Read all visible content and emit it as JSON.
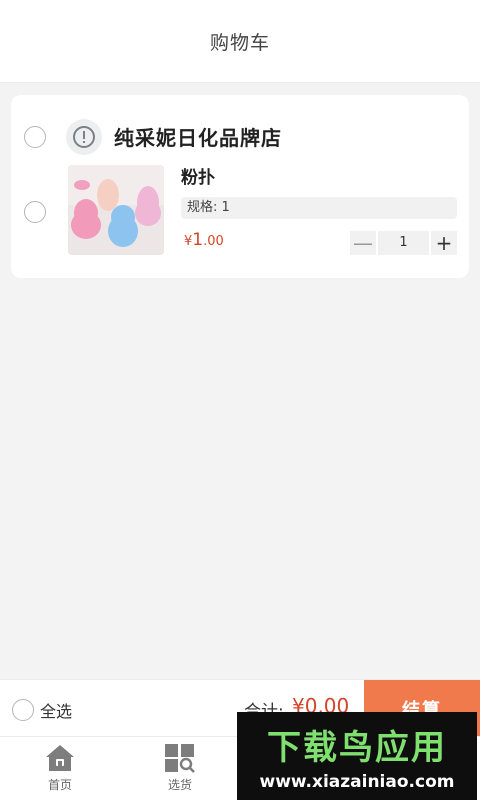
{
  "header": {
    "title": "购物车"
  },
  "shop": {
    "name": "纯采妮日化品牌店",
    "item": {
      "title": "粉扑",
      "spec": "规格: 1",
      "price_currency": "¥",
      "price_int": "1",
      "price_dec": ".00",
      "quantity": "1",
      "minus_label": "—",
      "plus_label": "+"
    }
  },
  "summary": {
    "select_all_label": "全选",
    "total_label": "合计:",
    "total_value": "¥0.00",
    "checkout_label": "结算"
  },
  "tabbar": {
    "items": [
      {
        "label": "首页",
        "icon": "home-icon"
      },
      {
        "label": "选货",
        "icon": "grid-search-icon"
      }
    ]
  },
  "watermark": {
    "title": "下载鸟应用",
    "url": "www.xiazainiao.com"
  },
  "colors": {
    "accent": "#f07a4c",
    "price": "#d2452a",
    "background": "#f3f3f3",
    "watermark_green": "#7fe06f"
  }
}
